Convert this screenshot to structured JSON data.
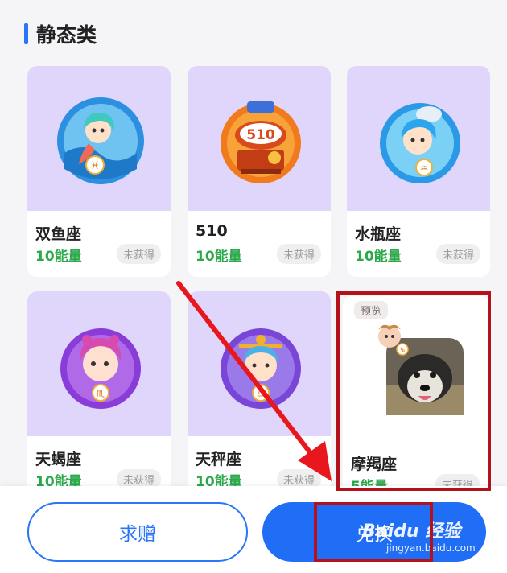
{
  "section": {
    "title": "静态类"
  },
  "cards": [
    {
      "name": "双鱼座",
      "price": "10能量",
      "status": "未获得"
    },
    {
      "name": "510",
      "price": "10能量",
      "status": "未获得"
    },
    {
      "name": "水瓶座",
      "price": "10能量",
      "status": "未获得"
    },
    {
      "name": "天蝎座",
      "price": "10能量",
      "status": "未获得"
    },
    {
      "name": "天秤座",
      "price": "10能量",
      "status": "未获得"
    },
    {
      "name": "摩羯座",
      "price": "5能量",
      "status": "未获得",
      "tag": "预览"
    }
  ],
  "actions": {
    "request_label": "求赠",
    "redeem_label": "兑换"
  },
  "watermark": {
    "main": "Baidu 经验",
    "sub": "jingyan.baidu.com"
  },
  "colors": {
    "accent": "#2a76f6",
    "energy": "#2aa84a",
    "card_bg": "#e0d6fb",
    "highlight": "#b3121b"
  }
}
